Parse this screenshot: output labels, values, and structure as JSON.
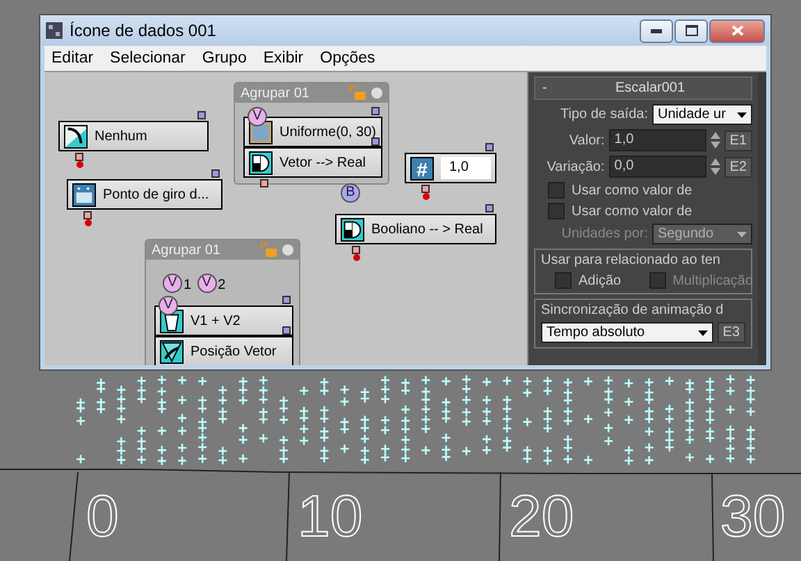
{
  "window": {
    "title": "Ícone de dados 001"
  },
  "menu": [
    "Editar",
    "Selecionar",
    "Grupo",
    "Exibir",
    "Opções"
  ],
  "groups": [
    {
      "title": "Agrupar 01",
      "nodes": [
        {
          "label": "Uniforme(0, 30)",
          "kind": "random",
          "badge": "V"
        },
        {
          "label": "Vetor --> Real",
          "kind": "convert"
        }
      ]
    },
    {
      "title": "Agrupar 01",
      "inputs": [
        {
          "badge": "V",
          "label": "1"
        },
        {
          "badge": "V",
          "label": "2"
        }
      ],
      "nodes": [
        {
          "label": "V1 + V2",
          "kind": "add",
          "badge": "V"
        },
        {
          "label": "Posição Vetor",
          "kind": "position"
        }
      ]
    }
  ],
  "nodes": [
    {
      "label": "Nenhum",
      "kind": "curve"
    },
    {
      "label": "Ponto de giro d...",
      "kind": "pivot"
    },
    {
      "label": "1,0",
      "kind": "number",
      "symbol": "#"
    },
    {
      "label": "Booliano -- > Real",
      "kind": "convert",
      "badge": "B"
    }
  ],
  "panel": {
    "title": "Escalar001",
    "collapse": "-",
    "output_type": {
      "label": "Tipo de saída:",
      "value": "Unidade ur"
    },
    "spinners": [
      {
        "label": "Valor:",
        "value": "1,0",
        "button": "E1"
      },
      {
        "label": "Variação:",
        "value": "0,0",
        "button": "E2"
      }
    ],
    "checks": [
      {
        "label": "Usar como valor de",
        "checked": false
      },
      {
        "label": "Usar como valor de",
        "checked": false
      }
    ],
    "units": {
      "label": "Unidades por:",
      "value": "Segundo",
      "disabled": true
    },
    "relation": {
      "title": "Usar para relacionado ao ten",
      "checks": [
        {
          "label": "Adição",
          "checked": false,
          "disabled": false
        },
        {
          "label": "Multiplicação",
          "checked": false,
          "disabled": true
        }
      ]
    },
    "sync": {
      "title": "Sincronização de animação d",
      "value": "Tempo absoluto",
      "button": "E3"
    }
  },
  "viewport": {
    "labels": [
      "0",
      "10",
      "20",
      "30"
    ]
  }
}
